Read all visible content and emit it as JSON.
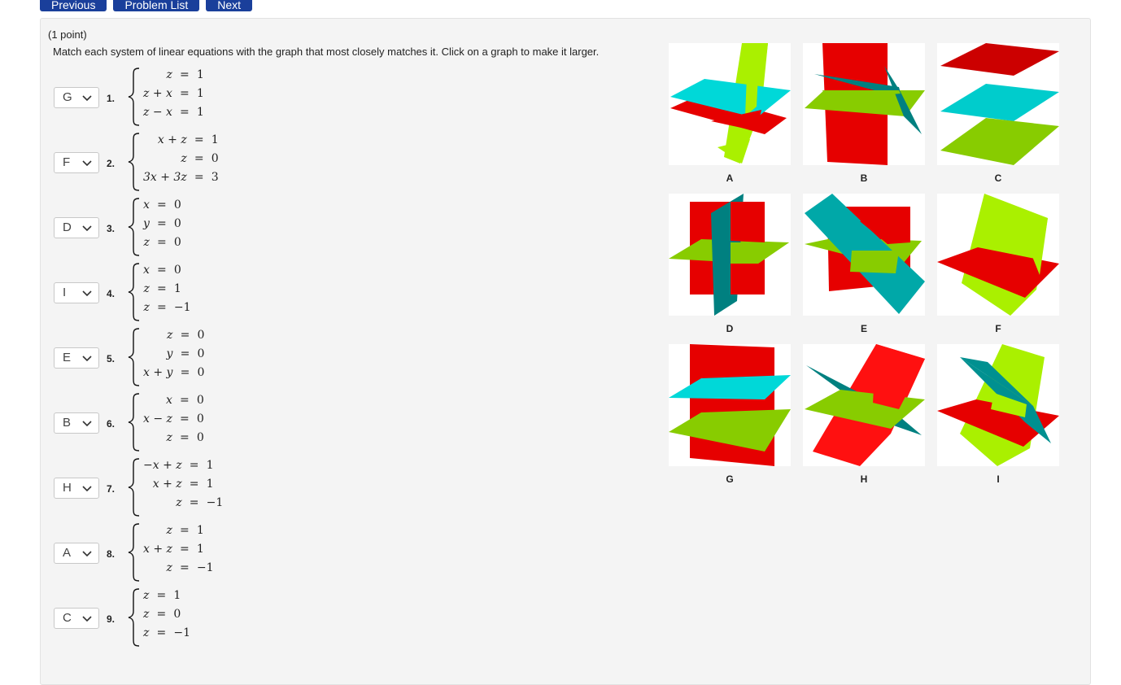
{
  "nav": {
    "previous": "Previous",
    "problem_list": "Problem List",
    "next": "Next"
  },
  "header": {
    "points": "(1 point)",
    "instructions": "Match each system of linear equations with the graph that most closely matches it. Click on a graph to make it larger."
  },
  "problems": [
    {
      "number": "1.",
      "selected": "G",
      "rows": [
        {
          "lhs": "z",
          "op": "=",
          "rhs": "1"
        },
        {
          "lhs": "z + x",
          "op": "=",
          "rhs": "1"
        },
        {
          "lhs": "z − x",
          "op": "=",
          "rhs": "1"
        }
      ]
    },
    {
      "number": "2.",
      "selected": "F",
      "rows": [
        {
          "lhs": "x + z",
          "op": "=",
          "rhs": "1"
        },
        {
          "lhs": "z",
          "op": "=",
          "rhs": "0"
        },
        {
          "lhs": "3x + 3z",
          "op": "=",
          "rhs": "3"
        }
      ]
    },
    {
      "number": "3.",
      "selected": "D",
      "rows": [
        {
          "lhs": "x",
          "op": "=",
          "rhs": "0"
        },
        {
          "lhs": "y",
          "op": "=",
          "rhs": "0"
        },
        {
          "lhs": "z",
          "op": "=",
          "rhs": "0"
        }
      ]
    },
    {
      "number": "4.",
      "selected": "I",
      "rows": [
        {
          "lhs": "x",
          "op": "=",
          "rhs": "0"
        },
        {
          "lhs": "z",
          "op": "=",
          "rhs": "1"
        },
        {
          "lhs": "z",
          "op": "=",
          "rhs": "−1"
        }
      ]
    },
    {
      "number": "5.",
      "selected": "E",
      "rows": [
        {
          "lhs": "z",
          "op": "=",
          "rhs": "0"
        },
        {
          "lhs": "y",
          "op": "=",
          "rhs": "0"
        },
        {
          "lhs": "x + y",
          "op": "=",
          "rhs": "0"
        }
      ]
    },
    {
      "number": "6.",
      "selected": "B",
      "rows": [
        {
          "lhs": "x",
          "op": "=",
          "rhs": "0"
        },
        {
          "lhs": "x − z",
          "op": "=",
          "rhs": "0"
        },
        {
          "lhs": "z",
          "op": "=",
          "rhs": "0"
        }
      ]
    },
    {
      "number": "7.",
      "selected": "H",
      "rows": [
        {
          "lhs": "−x + z",
          "op": "=",
          "rhs": "1"
        },
        {
          "lhs": "x + z",
          "op": "=",
          "rhs": "1"
        },
        {
          "lhs": "z",
          "op": "=",
          "rhs": "−1"
        }
      ]
    },
    {
      "number": "8.",
      "selected": "A",
      "rows": [
        {
          "lhs": "z",
          "op": "=",
          "rhs": "1"
        },
        {
          "lhs": "x + z",
          "op": "=",
          "rhs": "1"
        },
        {
          "lhs": "z",
          "op": "=",
          "rhs": "−1"
        }
      ]
    },
    {
      "number": "9.",
      "selected": "C",
      "rows": [
        {
          "lhs": "z",
          "op": "=",
          "rhs": "1"
        },
        {
          "lhs": "z",
          "op": "=",
          "rhs": "0"
        },
        {
          "lhs": "z",
          "op": "=",
          "rhs": "−1"
        }
      ]
    }
  ],
  "graphs": [
    {
      "label": "A"
    },
    {
      "label": "B"
    },
    {
      "label": "C"
    },
    {
      "label": "D"
    },
    {
      "label": "E"
    },
    {
      "label": "F"
    },
    {
      "label": "G"
    },
    {
      "label": "H"
    },
    {
      "label": "I"
    }
  ],
  "colors": {
    "red": "#e60000",
    "cyan": "#00d8d8",
    "teal": "#008080",
    "green": "#88cc00",
    "lime": "#aaf000",
    "nav": "#1a3f9b"
  }
}
